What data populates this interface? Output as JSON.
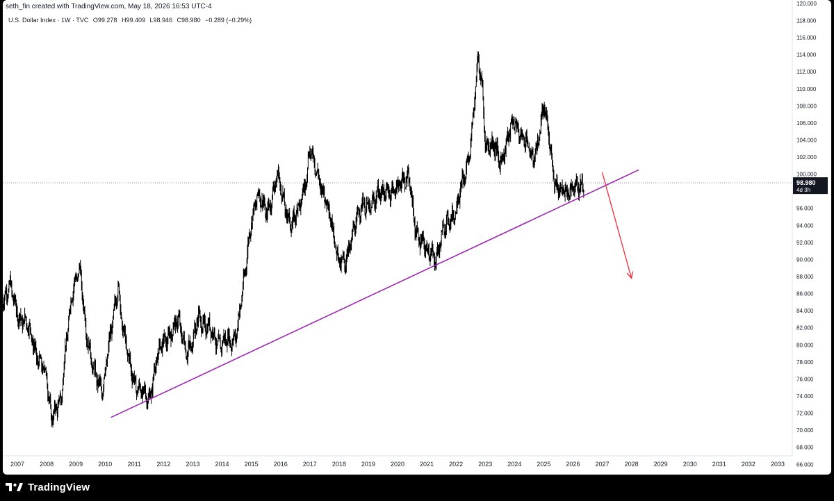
{
  "header": {
    "caption": "seth_fin created with TradingView.com, May 18, 2026 16:53 UTC-4",
    "symbol": "U.S. Dollar Index · 1W · TVC",
    "open": "O99.278",
    "high": "H99.409",
    "low": "L98.946",
    "close": "C98.980",
    "change": "−0.289 (−0.29%)"
  },
  "price_badge": {
    "price": "98.980",
    "countdown": "4d 3h"
  },
  "brand": {
    "label": "TradingView",
    "icon": "tradingview-logo-icon"
  },
  "colors": {
    "page_bg": "#000000",
    "chart_bg": "#ffffff",
    "candles": "#000000",
    "trendline": "#9c27b0",
    "forecast_arrow": "#f23645",
    "price_line": "#787b86",
    "axis_text": "#131722"
  },
  "chart_data": {
    "type": "line",
    "title": "U.S. Dollar Index",
    "interval": "1W",
    "source": "TVC",
    "xlabel": "",
    "ylabel": "",
    "x_ticks": [
      "2007",
      "2008",
      "2009",
      "2010",
      "2011",
      "2012",
      "2013",
      "2014",
      "2015",
      "2016",
      "2017",
      "2018",
      "2019",
      "2020",
      "2021",
      "2022",
      "2023",
      "2024",
      "2025",
      "2026",
      "2027",
      "2028",
      "2029",
      "2030",
      "2031",
      "2032",
      "2033"
    ],
    "y_ticks": [
      "66.000",
      "68.000",
      "70.000",
      "72.000",
      "74.000",
      "76.000",
      "78.000",
      "80.000",
      "82.000",
      "84.000",
      "86.000",
      "88.000",
      "90.000",
      "92.000",
      "94.000",
      "96.000",
      "98.000",
      "100.000",
      "102.000",
      "104.000",
      "106.000",
      "108.000",
      "110.000",
      "112.000",
      "114.000",
      "116.000",
      "118.000",
      "120.000"
    ],
    "xlim": [
      2006.5,
      2033.5
    ],
    "ylim": [
      64.8,
      120.4
    ],
    "axis_side": "right",
    "grid": false,
    "series": [
      {
        "style": "weekly price bars",
        "x": [
          2006.5,
          2006.75,
          2007.0,
          2007.25,
          2007.5,
          2007.75,
          2008.0,
          2008.15,
          2008.3,
          2008.5,
          2008.65,
          2008.85,
          2009.15,
          2009.35,
          2009.6,
          2009.9,
          2010.2,
          2010.45,
          2010.6,
          2010.8,
          2011.0,
          2011.3,
          2011.5,
          2011.7,
          2011.9,
          2012.2,
          2012.5,
          2012.8,
          2013.0,
          2013.2,
          2013.5,
          2013.8,
          2014.0,
          2014.3,
          2014.5,
          2014.75,
          2015.0,
          2015.2,
          2015.5,
          2015.9,
          2016.2,
          2016.4,
          2016.6,
          2016.9,
          2017.0,
          2017.3,
          2017.6,
          2017.8,
          2018.0,
          2018.2,
          2018.5,
          2018.8,
          2019.0,
          2019.3,
          2019.6,
          2019.9,
          2020.2,
          2020.4,
          2020.6,
          2020.9,
          2021.0,
          2021.3,
          2021.5,
          2021.8,
          2022.0,
          2022.3,
          2022.5,
          2022.75,
          2022.9,
          2023.0,
          2023.3,
          2023.5,
          2023.8,
          2024.0,
          2024.3,
          2024.6,
          2024.8,
          2025.0,
          2025.2,
          2025.4,
          2025.6,
          2025.8,
          2026.0,
          2026.2,
          2026.38
        ],
        "values": [
          85.5,
          86.5,
          84.0,
          82.5,
          81.0,
          78.0,
          76.0,
          72.0,
          72.5,
          73.0,
          80.0,
          86.0,
          88.5,
          82.0,
          76.5,
          75.0,
          81.0,
          87.5,
          82.0,
          78.0,
          76.0,
          74.0,
          73.5,
          77.5,
          79.5,
          81.5,
          82.5,
          79.5,
          80.0,
          83.5,
          82.0,
          80.5,
          80.5,
          80.0,
          82.0,
          87.0,
          95.0,
          97.5,
          95.5,
          99.5,
          96.0,
          93.5,
          96.0,
          100.0,
          102.5,
          100.0,
          96.0,
          93.5,
          90.0,
          89.0,
          94.0,
          96.0,
          96.5,
          97.0,
          98.5,
          97.5,
          100.0,
          99.0,
          93.5,
          92.0,
          90.5,
          90.5,
          92.5,
          95.0,
          96.0,
          99.5,
          104.0,
          113.0,
          110.0,
          104.0,
          103.0,
          101.5,
          104.5,
          106.0,
          104.5,
          101.5,
          104.0,
          107.5,
          104.0,
          99.0,
          97.5,
          98.0,
          99.0,
          98.0,
          98.98
        ]
      },
      {
        "name": "",
        "style": "trendline",
        "x": [
          2010.2,
          2028.25
        ],
        "values": [
          71.5,
          100.5
        ]
      },
      {
        "name": "",
        "style": "forecast arrow",
        "x": [
          2027.0,
          2028.0
        ],
        "values": [
          100.2,
          87.8
        ]
      }
    ],
    "last_price": 98.98,
    "price_line": "dotted horizontal at last price"
  }
}
